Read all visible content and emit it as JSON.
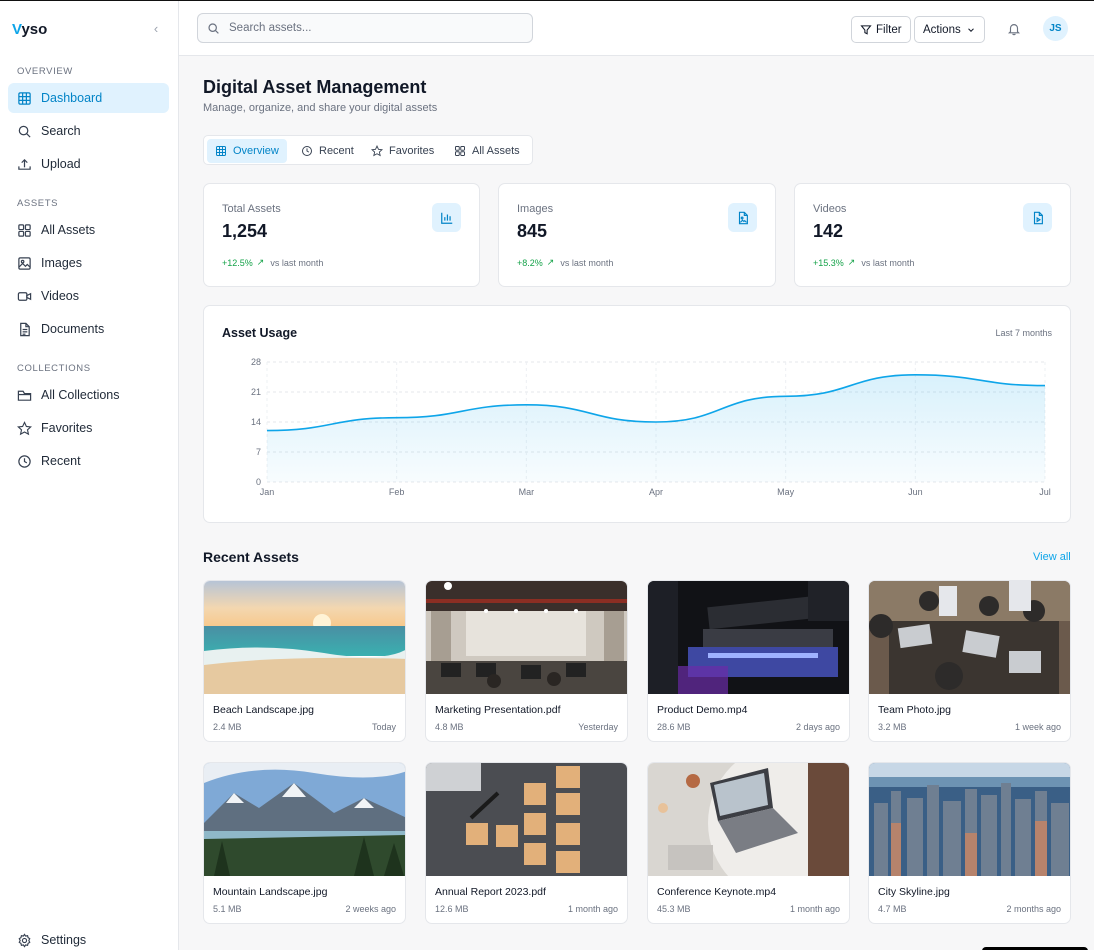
{
  "brand": {
    "initial": "V",
    "rest": "yso"
  },
  "sidebar": {
    "sections": [
      "OVERVIEW",
      "ASSETS",
      "COLLECTIONS"
    ],
    "items": [
      {
        "label": "Dashboard",
        "icon": "grid-icon"
      },
      {
        "label": "Search",
        "icon": "search-icon"
      },
      {
        "label": "Upload",
        "icon": "upload-icon"
      },
      {
        "label": "All Assets",
        "icon": "apps-icon"
      },
      {
        "label": "Images",
        "icon": "image-icon"
      },
      {
        "label": "Videos",
        "icon": "video-icon"
      },
      {
        "label": "Documents",
        "icon": "document-icon"
      },
      {
        "label": "All Collections",
        "icon": "folder-icon"
      },
      {
        "label": "Favorites",
        "icon": "star-icon"
      },
      {
        "label": "Recent",
        "icon": "clock-icon"
      }
    ],
    "settings_label": "Settings"
  },
  "topbar": {
    "search_placeholder": "Search assets...",
    "filter_label": "Filter",
    "actions_label": "Actions",
    "avatar_initials": "JS"
  },
  "page": {
    "title": "Digital Asset Management",
    "subtitle": "Manage, organize, and share your digital assets"
  },
  "tabs": [
    "Overview",
    "Recent",
    "Favorites",
    "All Assets"
  ],
  "stats": [
    {
      "label": "Total Assets",
      "value": "1,254",
      "change": "+12.5%",
      "note": "vs last month"
    },
    {
      "label": "Images",
      "value": "845",
      "change": "+8.2%",
      "note": "vs last month"
    },
    {
      "label": "Videos",
      "value": "142",
      "change": "+15.3%",
      "note": "vs last month"
    }
  ],
  "usage": {
    "title": "Asset Usage",
    "range": "Last 7 months"
  },
  "chart_data": {
    "type": "area",
    "categories": [
      "Jan",
      "Feb",
      "Mar",
      "Apr",
      "May",
      "Jun",
      "Jul"
    ],
    "values": [
      12,
      15,
      18,
      14,
      20,
      25,
      22.5
    ],
    "yticks": [
      0,
      7,
      14,
      21,
      28
    ],
    "ylim": [
      0,
      28
    ],
    "grid": true,
    "color": "#0ea5e9"
  },
  "recent": {
    "title": "Recent Assets",
    "view_all": "View all"
  },
  "assets": [
    {
      "name": "Beach Landscape.jpg",
      "size": "2.4 MB",
      "date": "Today"
    },
    {
      "name": "Marketing Presentation.pdf",
      "size": "4.8 MB",
      "date": "Yesterday"
    },
    {
      "name": "Product Demo.mp4",
      "size": "28.6 MB",
      "date": "2 days ago"
    },
    {
      "name": "Team Photo.jpg",
      "size": "3.2 MB",
      "date": "1 week ago"
    },
    {
      "name": "Mountain Landscape.jpg",
      "size": "5.1 MB",
      "date": "2 weeks ago"
    },
    {
      "name": "Annual Report 2023.pdf",
      "size": "12.6 MB",
      "date": "1 month ago"
    },
    {
      "name": "Conference Keynote.mp4",
      "size": "45.3 MB",
      "date": "1 month ago"
    },
    {
      "name": "City Skyline.jpg",
      "size": "4.7 MB",
      "date": "2 months ago"
    }
  ],
  "colors": {
    "accent": "#0ea5e9",
    "accent_bg": "#e0f2fe",
    "positive": "#16a34a"
  }
}
